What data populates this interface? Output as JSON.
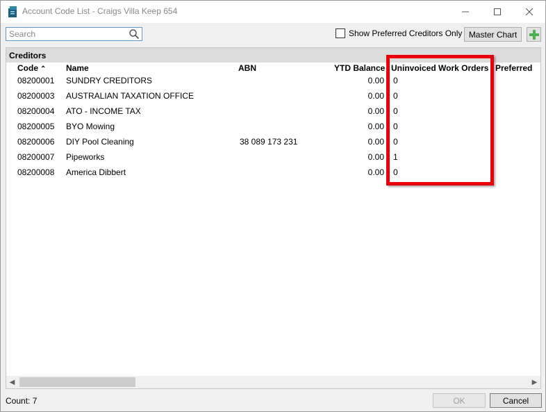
{
  "window": {
    "title": "Account Code List - Craigs Villa Keep 654"
  },
  "toolbar": {
    "search_placeholder": "Search",
    "search_value": "",
    "show_preferred_label": "Show Preferred Creditors Only",
    "show_preferred_checked": false,
    "master_chart_label": "Master Chart"
  },
  "grid": {
    "group_title": "Creditors",
    "columns": {
      "code": "Code",
      "name": "Name",
      "abn": "ABN",
      "ytd_balance": "YTD Balance",
      "uninvoiced": "Uninvoiced Work Orders",
      "preferred": "Preferred"
    },
    "rows": [
      {
        "code": "08200001",
        "name": "SUNDRY CREDITORS",
        "abn": "",
        "ytd": "0.00",
        "uninvoiced": "0"
      },
      {
        "code": "08200003",
        "name": "AUSTRALIAN TAXATION OFFICE",
        "abn": "",
        "ytd": "0.00",
        "uninvoiced": "0"
      },
      {
        "code": "08200004",
        "name": "ATO - INCOME TAX",
        "abn": "",
        "ytd": "0.00",
        "uninvoiced": "0"
      },
      {
        "code": "08200005",
        "name": "BYO Mowing",
        "abn": "",
        "ytd": "0.00",
        "uninvoiced": "0"
      },
      {
        "code": "08200006",
        "name": "DIY Pool Cleaning",
        "abn": "38 089 173 231",
        "ytd": "0.00",
        "uninvoiced": "0"
      },
      {
        "code": "08200007",
        "name": "Pipeworks",
        "abn": "",
        "ytd": "0.00",
        "uninvoiced": "1"
      },
      {
        "code": "08200008",
        "name": "America Dibbert",
        "abn": "",
        "ytd": "0.00",
        "uninvoiced": "0"
      }
    ]
  },
  "footer": {
    "count_label": "Count: 7",
    "ok_label": "OK",
    "cancel_label": "Cancel"
  },
  "colors": {
    "highlight": "#e8000b",
    "add_icon": "#4caf50",
    "search_border": "#5c9bd1"
  }
}
